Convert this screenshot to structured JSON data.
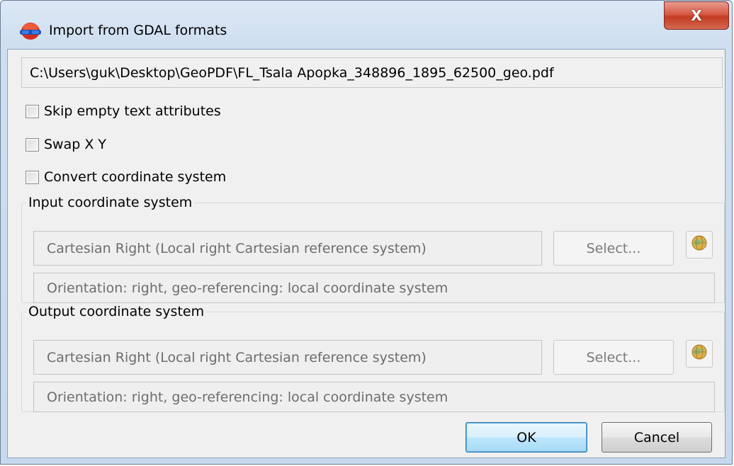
{
  "window": {
    "title": "Import from GDAL formats",
    "close_label": "X",
    "app_icon": "app-icon"
  },
  "file_path": "C:\\Users\\guk\\Desktop\\GeoPDF\\FL_Tsala Apopka_348896_1895_62500_geo.pdf",
  "options": {
    "skip_empty": {
      "label": "Skip empty text attributes",
      "checked": false
    },
    "swap_xy": {
      "label": "Swap X Y",
      "checked": false
    },
    "convert_cs": {
      "label": "Convert coordinate system",
      "checked": false
    }
  },
  "input_cs": {
    "legend": "Input coordinate system",
    "system": "Cartesian Right (Local right Cartesian reference system)",
    "select_label": "Select...",
    "orientation": "Orientation: right, geo-referencing: local coordinate system",
    "globe_icon": "globe-icon"
  },
  "output_cs": {
    "legend": "Output coordinate system",
    "system": "Cartesian Right (Local right Cartesian reference system)",
    "select_label": "Select...",
    "orientation": "Orientation: right, geo-referencing: local coordinate system",
    "globe_icon": "globe-icon"
  },
  "buttons": {
    "ok": "OK",
    "cancel": "Cancel"
  },
  "colors": {
    "titlebar": "#cfdff0",
    "close_button": "#c33b22",
    "ok_border": "#3c7fb1",
    "disabled_text": "#6d6d6d"
  }
}
